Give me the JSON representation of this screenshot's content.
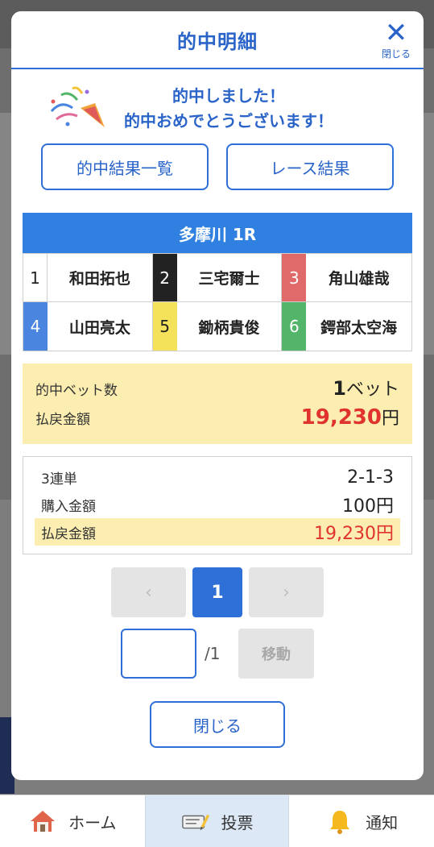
{
  "modal": {
    "title": "的中明細",
    "close_label": "閉じる",
    "congrats_line1": "的中しました！",
    "congrats_line2": "的中おめでとうございます！",
    "hit_results_button": "的中結果一覧",
    "race_results_button": "レース結果",
    "race_name": "多摩川 1R",
    "racers": [
      {
        "num": "1",
        "name": "和田拓也",
        "bg": "#ffffff",
        "fg": "#222222"
      },
      {
        "num": "2",
        "name": "三宅爾士",
        "bg": "#222222",
        "fg": "#ffffff"
      },
      {
        "num": "3",
        "name": "角山雄哉",
        "bg": "#e06a6a",
        "fg": "#ffffff"
      },
      {
        "num": "4",
        "name": "山田亮太",
        "bg": "#4a86e0",
        "fg": "#ffffff"
      },
      {
        "num": "5",
        "name": "鋤柄貴俊",
        "bg": "#f3e25a",
        "fg": "#222222"
      },
      {
        "num": "6",
        "name": "鍔部太空海",
        "bg": "#53b56a",
        "fg": "#ffffff"
      }
    ],
    "summary": {
      "bet_count_label": "的中ベット数",
      "bet_count_value": "1",
      "bet_count_unit": "ベット",
      "payout_label": "払戻金額",
      "payout_value": "19,230",
      "payout_unit": "円"
    },
    "detail": {
      "bet_type": "3連単",
      "combination": "2-1-3",
      "purchase_label": "購入金額",
      "purchase_value": "100円",
      "payout_label": "払戻金額",
      "payout_value": "19,230円"
    },
    "pager": {
      "prev": "‹",
      "current": "1",
      "next": "›"
    },
    "jump": {
      "total": "/1",
      "button": "移動",
      "input_value": ""
    },
    "close_button": "閉じる"
  },
  "nav": {
    "home": "ホーム",
    "vote": "投票",
    "notify": "通知"
  },
  "colors": {
    "accent": "#2f6fd8",
    "payout_red": "#e0322f",
    "highlight": "#fbeeb0"
  }
}
